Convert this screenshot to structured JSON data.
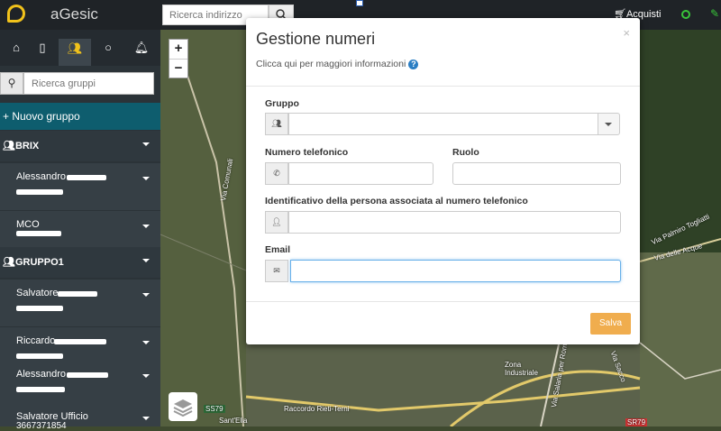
{
  "header": {
    "app_name": "aGesic",
    "address_search_placeholder": "Ricerca indirizzo",
    "purchases_label": "Acquisti"
  },
  "sidebar": {
    "group_search_placeholder": "Ricerca gruppi",
    "new_group_label": "+ Nuovo gruppo",
    "groups": [
      {
        "name": "BRIX",
        "members": [
          "Alessandro",
          "MCO"
        ]
      },
      {
        "name": "GRUPPO1",
        "members": [
          "Salvatore",
          "Riccardo",
          "Alessandro",
          "Salvatore Ufficio"
        ]
      }
    ],
    "last_member_number": "3667371854"
  },
  "map": {
    "zoom_in": "+",
    "zoom_out": "−",
    "labels": {
      "via_comunali": "Via Comunali",
      "via_palmiro": "Via Palmiro Togliatti",
      "via_delle_acque": "Via delle Acque",
      "raccordo": "Raccordo Rieti-Terni",
      "sant_elia": "Sant'Elia",
      "ss79": "SS79",
      "zona_industriale": "Zona Industriale",
      "via_salaria": "Via Salaria per Roma",
      "via_sacco": "Via Sacco",
      "sr79": "SR79"
    }
  },
  "modal": {
    "title": "Gestione numeri",
    "info_text": "Clicca qui per maggiori informazioni",
    "close_symbol": "×",
    "fields": {
      "group_label": "Gruppo",
      "phone_label": "Numero telefonico",
      "role_label": "Ruolo",
      "person_id_label": "Identificativo della persona associata al numero telefonico",
      "email_label": "Email"
    },
    "save_label": "Salva"
  },
  "colors": {
    "accent": "#f1c21b",
    "new_group_bg": "#0e5d6e",
    "save_button": "#f0ad4e",
    "info_icon": "#2a7ec4",
    "status_green": "#39c43a"
  },
  "icons": [
    "logo-icon",
    "search-icon",
    "cart-icon",
    "status-icon",
    "edit-icon",
    "home-icon",
    "phone-icon",
    "users-icon",
    "circle-icon",
    "bell-icon",
    "layers-icon",
    "user-icon",
    "envelope-icon",
    "info-icon"
  ]
}
